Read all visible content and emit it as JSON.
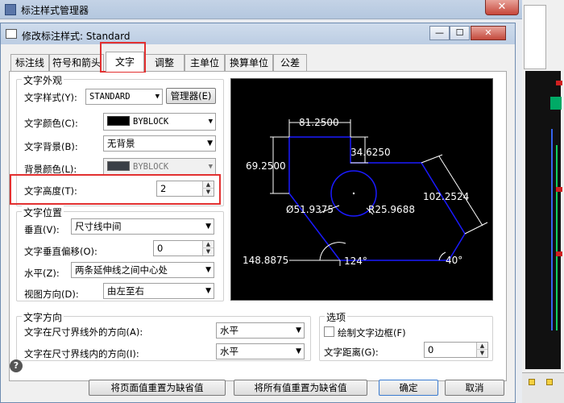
{
  "outer_window": {
    "title": "标注样式管理器",
    "close_glyph": "✕"
  },
  "dialog": {
    "title": "修改标注样式: Standard",
    "controls": {
      "minimize": "—",
      "maximize": "☐",
      "close": "✕"
    }
  },
  "tabs": [
    {
      "label": "标注线"
    },
    {
      "label": "符号和箭头"
    },
    {
      "label": "文字",
      "active": true
    },
    {
      "label": "调整"
    },
    {
      "label": "主单位"
    },
    {
      "label": "换算单位"
    },
    {
      "label": "公差"
    }
  ],
  "text_appearance": {
    "group_label": "文字外观",
    "style_label": "文字样式(Y):",
    "style_value": "STANDARD",
    "manager_button": "管理器(E)",
    "color_label": "文字颜色(C):",
    "color_value": "BYBLOCK",
    "color_swatch": "#000000",
    "background_label": "文字背景(B):",
    "background_value": "无背景",
    "bg_color_label": "背景颜色(L):",
    "bg_color_value": "BYBLOCK",
    "bg_color_swatch": "#3a3f46",
    "height_label": "文字高度(T):",
    "height_value": "2"
  },
  "text_position": {
    "group_label": "文字位置",
    "vertical_label": "垂直(V):",
    "vertical_value": "尺寸线中间",
    "vertical_offset_label": "文字垂直偏移(O):",
    "vertical_offset_value": "0",
    "horizontal_label": "水平(Z):",
    "horizontal_value": "两条延伸线之间中心处",
    "view_direction_label": "视图方向(D):",
    "view_direction_value": "由左至右"
  },
  "text_direction": {
    "group_label": "文字方向",
    "outside_label": "文字在尺寸界线外的方向(A):",
    "outside_value": "水平",
    "inside_label": "文字在尺寸界线内的方向(I):",
    "inside_value": "水平"
  },
  "options": {
    "group_label": "选项",
    "draw_frame_label": "绘制文字边框(F)",
    "draw_frame_checked": false,
    "distance_label": "文字距离(G):",
    "distance_value": "0"
  },
  "preview": {
    "dim_top": "81.2500",
    "dim_left": "69.2500",
    "dim_small": "34.6250",
    "dim_right": "102.2524",
    "dim_diameter": "Ø51.9375",
    "dim_radius": "R25.9688",
    "dim_bottom": "148.8875",
    "angle_1": "124°",
    "angle_2": "40°"
  },
  "footer": {
    "help": "?",
    "reset_page": "将页面值重置为缺省值",
    "reset_all": "将所有值重置为缺省值",
    "ok": "确定",
    "cancel": "取消"
  },
  "colors": {
    "highlight": "#e23030",
    "preview_background": "#000000",
    "geometry": "#1a1aff",
    "dimension": "#ffffff"
  }
}
